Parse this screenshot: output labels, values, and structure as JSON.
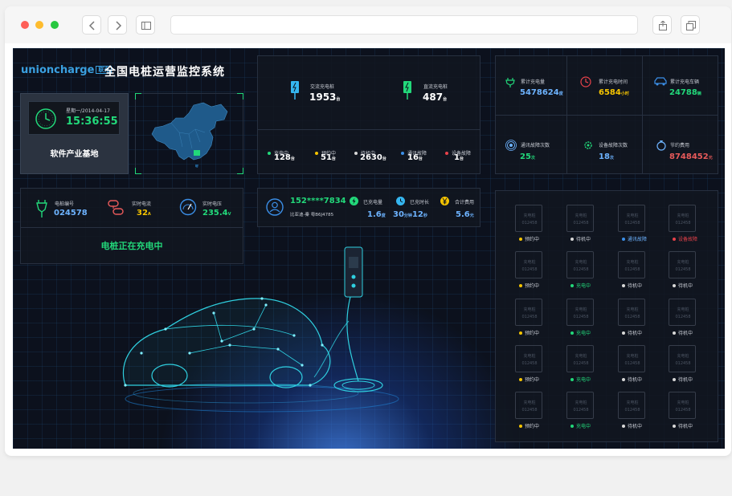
{
  "app": {
    "brand": "unioncharge",
    "brand_tag": "联充",
    "title": "全国电桩运营监控系统"
  },
  "clock": {
    "date": "星期一/2014-04-17",
    "time": "15:36:55",
    "location": "软件产业基地"
  },
  "pile_summary": {
    "ac_label": "交流充电桩",
    "ac_value": "1953",
    "ac_unit": "台",
    "dc_label": "直流充电桩",
    "dc_value": "487",
    "dc_unit": "台"
  },
  "status_counts": [
    {
      "label": "充电中",
      "value": "128",
      "unit": "台",
      "color": "#22d87a"
    },
    {
      "label": "预约中",
      "value": "51",
      "unit": "台",
      "color": "#f5c400"
    },
    {
      "label": "待机中",
      "value": "2630",
      "unit": "台",
      "color": "#d8d8d8"
    },
    {
      "label": "通讯故障",
      "value": "16",
      "unit": "台",
      "color": "#3b8fe8"
    },
    {
      "label": "设备故障",
      "value": "1",
      "unit": "台",
      "color": "#e8424a"
    }
  ],
  "totals": [
    {
      "label": "累计充电量",
      "value": "5478624",
      "unit": "度",
      "color": "#6db3ff",
      "icon": "plug-icon"
    },
    {
      "label": "累计充电时间",
      "value": "6584",
      "unit": "小时",
      "color": "#f5c400",
      "icon": "timer-icon"
    },
    {
      "label": "累计充电车辆",
      "value": "24788",
      "unit": "辆",
      "color": "#22d87a",
      "icon": "car-icon"
    },
    {
      "label": "通讯故障次数",
      "value": "25",
      "unit": "次",
      "color": "#22d87a",
      "icon": "signal-icon"
    },
    {
      "label": "设备故障次数",
      "value": "18",
      "unit": "次",
      "color": "#6db3ff",
      "icon": "gear-icon"
    },
    {
      "label": "节约费用",
      "value": "8748452",
      "unit": "元",
      "color": "#e85a5a",
      "icon": "money-icon"
    }
  ],
  "pile_detail": {
    "id_label": "电桩编号",
    "id_value": "024578",
    "current_label": "实时电流",
    "current_value": "32",
    "current_unit": "A",
    "voltage_label": "实时电压",
    "voltage_value": "235.4",
    "voltage_unit": "V",
    "status_text": "电桩正在充电中"
  },
  "user_info": {
    "phone": "152****7834",
    "name_plate": "比亚迪-秦 粤B6J4785",
    "charged_label": "已充电量",
    "charged_value": "1.6",
    "charged_unit": "度",
    "duration_label": "已充时长",
    "duration_min": "30",
    "duration_min_unit": "分钟",
    "duration_sec": "12",
    "duration_sec_unit": "秒",
    "cost_label": "合计费用",
    "cost_value": "5.6",
    "cost_unit": "元"
  },
  "grid": {
    "tile_line1": "充电桩",
    "tile_line2": "012458",
    "rows": [
      [
        "预约中",
        "待机中",
        "通讯故障",
        "设备故障"
      ],
      [
        "预约中",
        "充电中",
        "待机中",
        "待机中"
      ],
      [
        "预约中",
        "充电中",
        "待机中",
        "待机中"
      ],
      [
        "预约中",
        "充电中",
        "待机中",
        "待机中"
      ],
      [
        "预约中",
        "充电中",
        "待机中",
        "待机中"
      ]
    ],
    "status_colors": {
      "预约中": "#f5c400",
      "待机中": "#d8d8d8",
      "通讯故障": "#3b8fe8",
      "设备故障": "#e8424a",
      "充电中": "#22d87a"
    }
  }
}
